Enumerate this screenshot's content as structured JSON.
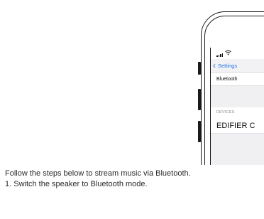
{
  "phone": {
    "status_bar": {
      "signal_icon": "signal-bars-icon",
      "wifi_icon": "wifi-icon"
    },
    "nav": {
      "back_icon": "chevron-left-icon",
      "back_label": "Settings"
    },
    "bluetooth_row_label": "Bluetooth",
    "devices_header": "DEVICES",
    "device_name": "EDIFIER C",
    "colors": {
      "accent": "#1e73e8",
      "grouped_background": "#f0f0f2"
    }
  },
  "instructions": {
    "intro": "Follow the steps below to stream music via Bluetooth.",
    "step_1": "1. Switch the speaker to Bluetooth mode."
  }
}
